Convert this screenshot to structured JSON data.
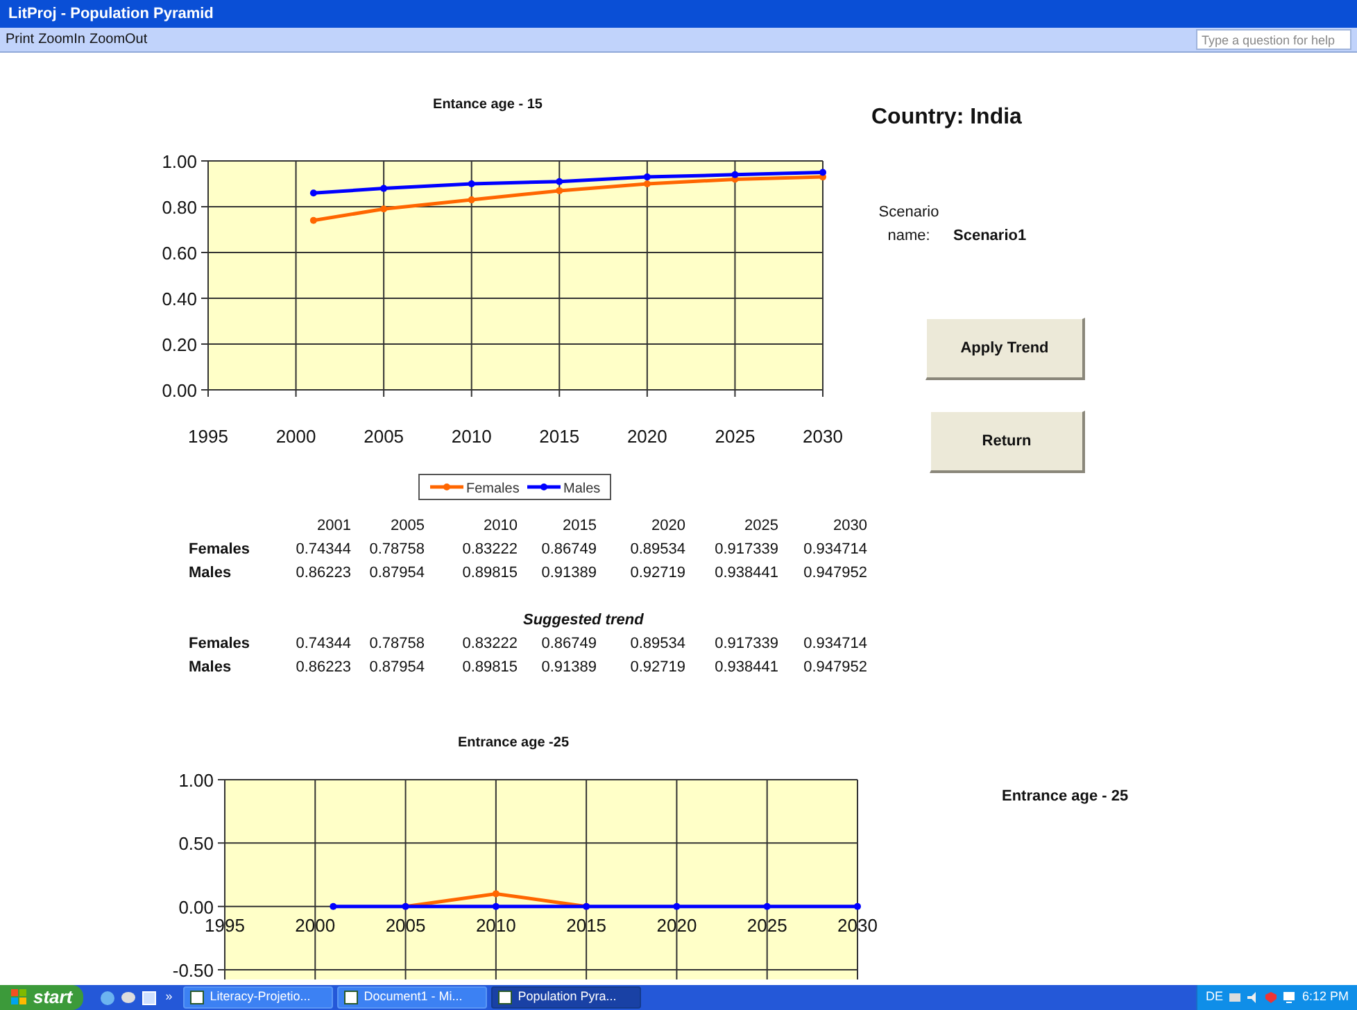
{
  "window": {
    "title": "LitProj - Population Pyramid"
  },
  "menu": [
    {
      "label": "Print"
    },
    {
      "label": "ZoomIn"
    },
    {
      "label": "ZoomOut"
    }
  ],
  "help_box": {
    "placeholder": "Type a question for help"
  },
  "charts": [
    {
      "chart_data": {
        "type": "line",
        "title": "Entance age - 15",
        "x": [
          2001,
          2005,
          2010,
          2015,
          2020,
          2025,
          2030
        ],
        "series": [
          {
            "name": "Females",
            "color": "#ff6600",
            "marker": "circle",
            "values": [
              0.74,
              0.79,
              0.83,
              0.87,
              0.9,
              0.92,
              0.93
            ]
          },
          {
            "name": "Males",
            "color": "#0000ff",
            "marker": "circle",
            "values": [
              0.86,
              0.88,
              0.9,
              0.91,
              0.93,
              0.94,
              0.95
            ]
          }
        ],
        "grid": true,
        "legend": true,
        "xlim": [
          1995,
          2030
        ],
        "ylim": [
          0,
          1
        ],
        "xticks": [
          {
            "value": 1995,
            "label": "1995"
          },
          {
            "value": 2000,
            "label": "2000"
          },
          {
            "value": 2005,
            "label": "2005"
          },
          {
            "value": 2010,
            "label": "2010"
          },
          {
            "value": 2015,
            "label": "2015"
          },
          {
            "value": 2020,
            "label": "2020"
          },
          {
            "value": 2025,
            "label": "2025"
          },
          {
            "value": 2030,
            "label": "2030"
          }
        ],
        "yticks": [
          {
            "value": 0,
            "label": "0.00"
          },
          {
            "value": 0.2,
            "label": "0.20"
          },
          {
            "value": 0.4,
            "label": "0.40"
          },
          {
            "value": 0.6,
            "label": "0.60"
          },
          {
            "value": 0.8,
            "label": "0.80"
          },
          {
            "value": 1,
            "label": "1.00"
          }
        ]
      }
    },
    {
      "chart_data": {
        "type": "line",
        "title": "Entrance age -25",
        "x": [
          2001,
          2005,
          2010,
          2015,
          2020,
          2025,
          2030
        ],
        "series": [
          {
            "color": "#ff6600",
            "marker": "circle",
            "values": [
              null,
              0,
              0.1,
              0,
              null,
              null,
              null
            ]
          },
          {
            "color": "#0000ff",
            "marker": "circle",
            "values": [
              0,
              0,
              0,
              0,
              0,
              0,
              0
            ]
          }
        ],
        "grid": true,
        "xlim": [
          1995,
          2030
        ],
        "ylim": [
          -0.5,
          1
        ],
        "xticks": [
          {
            "value": 1995,
            "label": "1995"
          },
          {
            "value": 2000,
            "label": "2000"
          },
          {
            "value": 2005,
            "label": "2005"
          },
          {
            "value": 2010,
            "label": "2010"
          },
          {
            "value": 2015,
            "label": "2015"
          },
          {
            "value": 2020,
            "label": "2020"
          },
          {
            "value": 2025,
            "label": "2025"
          },
          {
            "value": 2030,
            "label": "2030"
          }
        ],
        "yticks": [
          {
            "value": -0.5,
            "label": "-0.50"
          },
          {
            "value": 0,
            "label": "0.00"
          },
          {
            "value": 0.5,
            "label": "0.50"
          },
          {
            "value": 1,
            "label": "1.00"
          }
        ]
      }
    }
  ],
  "table": {
    "columns": [
      "2001",
      "2005",
      "2010",
      "2015",
      "2020",
      "2025",
      "2030"
    ],
    "rows": [
      {
        "label": "Females",
        "values": [
          "0.74344",
          "0.78758",
          "0.83222",
          "0.86749",
          "0.89534",
          "0.917339",
          "0.934714"
        ]
      },
      {
        "label": "Males",
        "values": [
          "0.86223",
          "0.87954",
          "0.89815",
          "0.91389",
          "0.92719",
          "0.938441",
          "0.947952"
        ]
      }
    ]
  },
  "suggested_trend": {
    "title": "Suggested trend",
    "rows": [
      {
        "label": "Females",
        "values": [
          "0.74344",
          "0.78758",
          "0.83222",
          "0.86749",
          "0.89534",
          "0.917339",
          "0.934714"
        ]
      },
      {
        "label": "Males",
        "values": [
          "0.86223",
          "0.87954",
          "0.89815",
          "0.91389",
          "0.92719",
          "0.938441",
          "0.947952"
        ]
      }
    ]
  },
  "country": "Country: India",
  "scenario": {
    "label": "Scenario name:",
    "value": "Scenario1"
  },
  "buttons": [
    "Apply Trend",
    "Return"
  ],
  "side_label": "Entrance age -  25",
  "taskbar": {
    "start": "start",
    "more": "»",
    "tasks": [
      {
        "label": "Literacy-Projetio...",
        "selected": false
      },
      {
        "label": "Document1 - Mi...",
        "selected": false
      },
      {
        "label": "Population Pyra...",
        "selected": true
      }
    ],
    "language": "DE",
    "clock": "6:12 PM"
  }
}
